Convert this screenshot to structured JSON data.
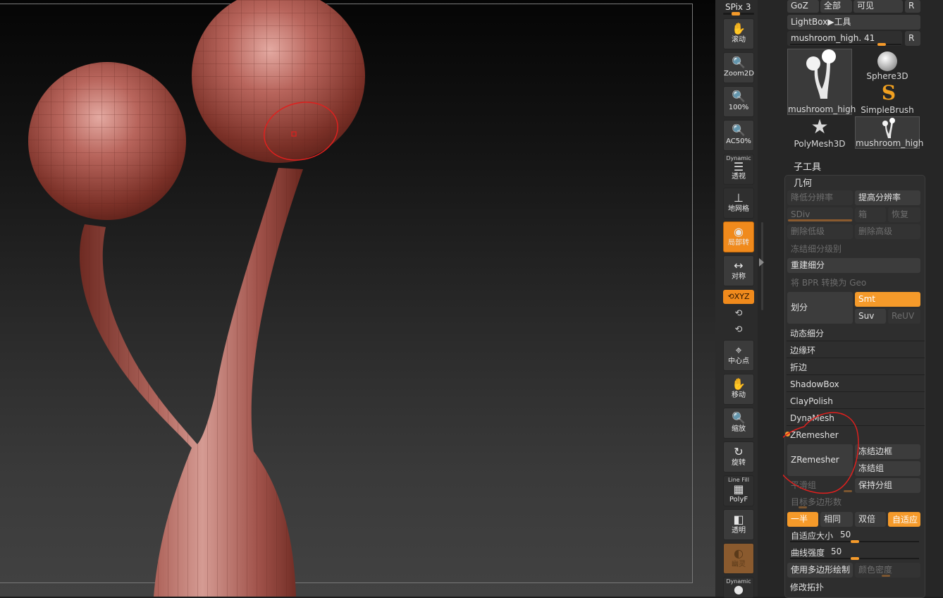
{
  "top_toolbar": {
    "spix_label": "SPix 3",
    "goz": "GoZ",
    "all": "全部",
    "visible": "可见",
    "r": "R"
  },
  "tool_header": {
    "lightbox": "LightBox▶工具",
    "tool_name": "mushroom_high. 41",
    "r": "R"
  },
  "tool_thumbs": [
    {
      "label": "mushroom_high"
    },
    {
      "label": "Sphere3D"
    },
    {
      "label": "SimpleBrush"
    },
    {
      "label": "PolyMesh3D"
    },
    {
      "label": "mushroom_high"
    }
  ],
  "shelf": {
    "scroll": "滚动",
    "zoom2d": "Zoom2D",
    "pct100": "100%",
    "ac50": "AC50%",
    "dynamic": "Dynamic",
    "perspective": "透视",
    "floor": "地网格",
    "local": "局部转",
    "symmetry": "对称",
    "xyz": "XYZ",
    "center": "中心点",
    "move": "移动",
    "scale": "缩放",
    "rotate": "旋转",
    "linefill": "Line Fill",
    "polyf": "PolyF",
    "transp": "透明",
    "ghost": "幽灵",
    "dynamic2": "Dynamic"
  },
  "subtool": {
    "label": "子工具"
  },
  "geometry": {
    "title": "几何",
    "lower_res": "降低分辨率",
    "higher_res": "提高分辨率",
    "sdiv": "SDiv",
    "cage": "箱",
    "restore": "恢复",
    "del_lower": "删除低级",
    "del_higher": "删除高级",
    "freeze_sub": "冻结细分级别",
    "reconstruct": "重建细分",
    "bpr_geo": "将 BPR 转换为 Geo",
    "divide": "划分",
    "smt": "Smt",
    "suv": "Suv",
    "reuv": "ReUV",
    "dynamic_sub": "动态细分",
    "edge_loop": "边缘环",
    "crease": "折边",
    "shadowbox": "ShadowBox",
    "claypolish": "ClayPolish",
    "dynamesh": "DynaMesh"
  },
  "zremesher": {
    "title": "ZRemesher",
    "button": "ZRemesher",
    "freeze_border": "冻结边框",
    "freeze_groups": "冻结组",
    "smooth_groups": "平滑组",
    "keep_groups": "保持分组",
    "target_poly": "目标多边形数",
    "half": "一半",
    "same": "相同",
    "double": "双倍",
    "adaptive": "自适应",
    "adaptive_size_label": "自适应大小",
    "adaptive_size_value": "50",
    "adaptive_size_level": 0.5,
    "curve_strength_label": "曲线强度",
    "curve_strength_value": "50",
    "curve_strength_level": 0.5,
    "use_polypaint": "使用多边形绘制",
    "color_density": "颜色密度"
  },
  "modify_topology": "修改拓扑",
  "colors": {
    "accent": "#f59a2a",
    "mesh": "#a5544c",
    "annotation": "#e0201e"
  }
}
